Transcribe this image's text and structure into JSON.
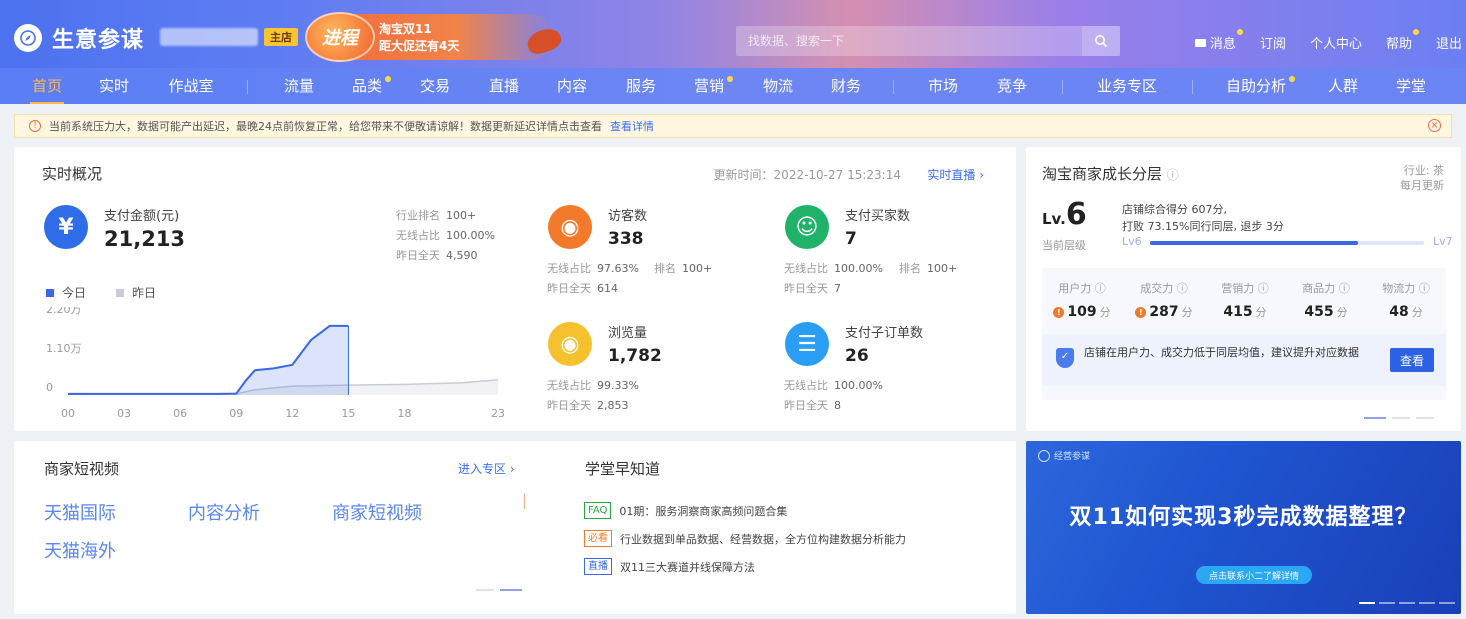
{
  "header": {
    "logo_text": "生意参谋",
    "main_shop_badge": "主店",
    "promo": {
      "badge": "进程",
      "line1": "淘宝双11",
      "line2": "距大促还有4天"
    },
    "search_placeholder": "找数据、搜索一下",
    "links": {
      "message": "消息",
      "subscribe": "订阅",
      "personal": "个人中心",
      "help": "帮助",
      "logout": "退出"
    }
  },
  "nav": [
    "首页",
    "实时",
    "作战室",
    "流量",
    "品类",
    "交易",
    "直播",
    "内容",
    "服务",
    "营销",
    "物流",
    "财务",
    "市场",
    "竞争",
    "业务专区",
    "自助分析",
    "人群",
    "学堂"
  ],
  "notice": {
    "text": "当前系统压力大，数据可能产出延迟，最晚24点前恢复正常，给您带来不便敬请谅解！数据更新延迟详情点击查看",
    "link": "查看详情"
  },
  "realtime": {
    "title": "实时概况",
    "update_time": "更新时间：2022-10-27 15:23:14",
    "live_link": "实时直播 ›",
    "pay": {
      "label": "支付金额(元)",
      "value": "21,213",
      "rank_label": "行业排名",
      "rank": "100+",
      "wireless_label": "无线占比",
      "wireless": "100.00%",
      "yesterday_label": "昨日全天",
      "yesterday": "4,590"
    },
    "visitors": {
      "label": "访客数",
      "value": "338",
      "wireless_label": "无线占比",
      "wireless": "97.63%",
      "rank_label": "排名",
      "rank": "100+",
      "yesterday_label": "昨日全天",
      "yesterday": "614"
    },
    "buyers": {
      "label": "支付买家数",
      "value": "7",
      "wireless_label": "无线占比",
      "wireless": "100.00%",
      "rank_label": "排名",
      "rank": "100+",
      "yesterday_label": "昨日全天",
      "yesterday": "7"
    },
    "pageviews": {
      "label": "浏览量",
      "value": "1,782",
      "wireless_label": "无线占比",
      "wireless": "99.33%",
      "yesterday_label": "昨日全天",
      "yesterday": "2,853"
    },
    "suborders": {
      "label": "支付子订单数",
      "value": "26",
      "wireless_label": "无线占比",
      "wireless": "100.00%",
      "yesterday_label": "昨日全天",
      "yesterday": "8"
    },
    "legend": {
      "today": "今日",
      "yesterday": "昨日"
    },
    "colors": {
      "today": "#3a67e6",
      "yesterday": "#c8ccd6",
      "pay": "#2f6de8",
      "visitors": "#f37a2a",
      "buyers": "#21b26a",
      "pageviews": "#f6c12f",
      "suborders": "#2a9df4"
    }
  },
  "chart_data": {
    "type": "area",
    "y_ticks": [
      "2.20万",
      "1.10万",
      "0"
    ],
    "x_ticks": [
      "00",
      "03",
      "06",
      "09",
      "12",
      "15",
      "18",
      "23"
    ],
    "ylim": [
      0,
      22000
    ],
    "xlim": [
      0,
      23
    ],
    "series": [
      {
        "name": "今日",
        "x": [
          0,
          1,
          2,
          3,
          4,
          5,
          6,
          7,
          8,
          9,
          9.5,
          10,
          11,
          12,
          13,
          14,
          15
        ],
        "y": [
          300,
          300,
          300,
          300,
          300,
          300,
          300,
          300,
          300,
          400,
          4000,
          7000,
          7500,
          8500,
          15500,
          19500,
          19500
        ]
      },
      {
        "name": "昨日",
        "x": [
          0,
          3,
          6,
          9,
          10,
          12,
          15,
          18,
          21,
          23
        ],
        "y": [
          200,
          200,
          200,
          300,
          1500,
          2500,
          2800,
          3000,
          3400,
          4300
        ]
      }
    ]
  },
  "growth": {
    "title": "淘宝商家成长分层",
    "industry": "行业: 茶",
    "frequency": "每月更新",
    "level_prefix": "Lv.",
    "level": "6",
    "level_caption": "当前层级",
    "desc_line1": "店铺综合得分 607分,",
    "desc_line2": "打败 73.15%同行同层, 退步 3分",
    "from": "Lv6",
    "to": "Lv7",
    "progress": 0.76,
    "powers": [
      {
        "label": "用户力",
        "value": "109",
        "unit": "分",
        "warn": true
      },
      {
        "label": "成交力",
        "value": "287",
        "unit": "分",
        "warn": true
      },
      {
        "label": "营销力",
        "value": "415",
        "unit": "分",
        "warn": false
      },
      {
        "label": "商品力",
        "value": "455",
        "unit": "分",
        "warn": false
      },
      {
        "label": "物流力",
        "value": "48",
        "unit": "分",
        "warn": false
      }
    ],
    "advice": "店铺在用户力、成交力低于同层均值，建议提升对应数据",
    "advice_button": "查看"
  },
  "short_video": {
    "title": "商家短视频",
    "enter_link": "进入专区 ›",
    "links": [
      "天猫国际",
      "内容分析",
      "商家短视频",
      "天猫海外"
    ]
  },
  "school": {
    "title": "学堂早知道",
    "items": [
      {
        "tag": "FAQ",
        "text": "01期：服务洞察商家高频问题合集",
        "color": "#28a745"
      },
      {
        "tag": "必看",
        "text": "行业数据到单品数据、经营数据，全方位构建数据分析能力",
        "color": "#f07a2c"
      },
      {
        "tag": "直播",
        "text": "双11三大赛道并线保障方法",
        "color": "#3a67e6"
      }
    ]
  },
  "banner": {
    "logo": "经营参谋",
    "title": "双11如何实现3秒完成数据整理？",
    "button": "点击联系小二了解详情"
  }
}
